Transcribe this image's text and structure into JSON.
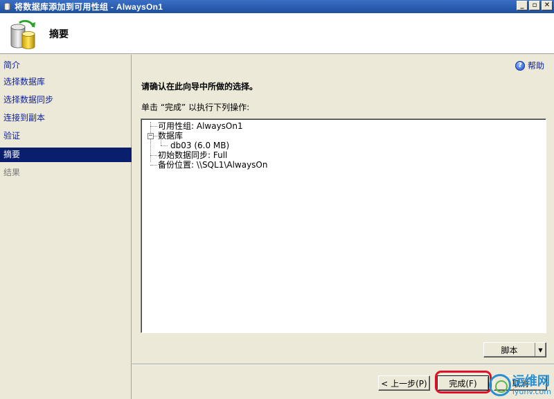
{
  "window": {
    "title": "将数据库添加到可用性组 - AlwaysOn1",
    "minimize_glyph": "_",
    "restore_glyph": "▫",
    "close_glyph": "✕"
  },
  "header": {
    "title": "摘要"
  },
  "nav": {
    "items": [
      {
        "label": "简介",
        "state": "link"
      },
      {
        "label": "选择数据库",
        "state": "link"
      },
      {
        "label": "选择数据同步",
        "state": "link"
      },
      {
        "label": "连接到副本",
        "state": "link"
      },
      {
        "label": "验证",
        "state": "link"
      },
      {
        "label": "摘要",
        "state": "active"
      },
      {
        "label": "结果",
        "state": "disabled"
      }
    ]
  },
  "content": {
    "help_label": "帮助",
    "heading": "请确认在此向导中所做的选择。",
    "instruction": "单击 “完成” 以执行下列操作:",
    "tree": {
      "availability_group": "可用性组: AlwaysOn1",
      "databases": "数据库",
      "database_item": "db03 (6.0 MB)",
      "initial_sync": "初始数据同步: Full",
      "backup_location": "备份位置: \\\\SQL1\\AlwaysOn",
      "expander_glyph": "−"
    }
  },
  "buttons": {
    "script": "脚本",
    "script_arrow": "▼",
    "prev": "< 上一步(P)",
    "finish": "完成(F)",
    "cancel": "取消"
  },
  "watermark": {
    "cn": "运维网",
    "en": "iyunv.com"
  },
  "colors": {
    "link": "#0a1ea0",
    "active_nav": "#0a1e6e",
    "highlight": "#e0102a"
  }
}
